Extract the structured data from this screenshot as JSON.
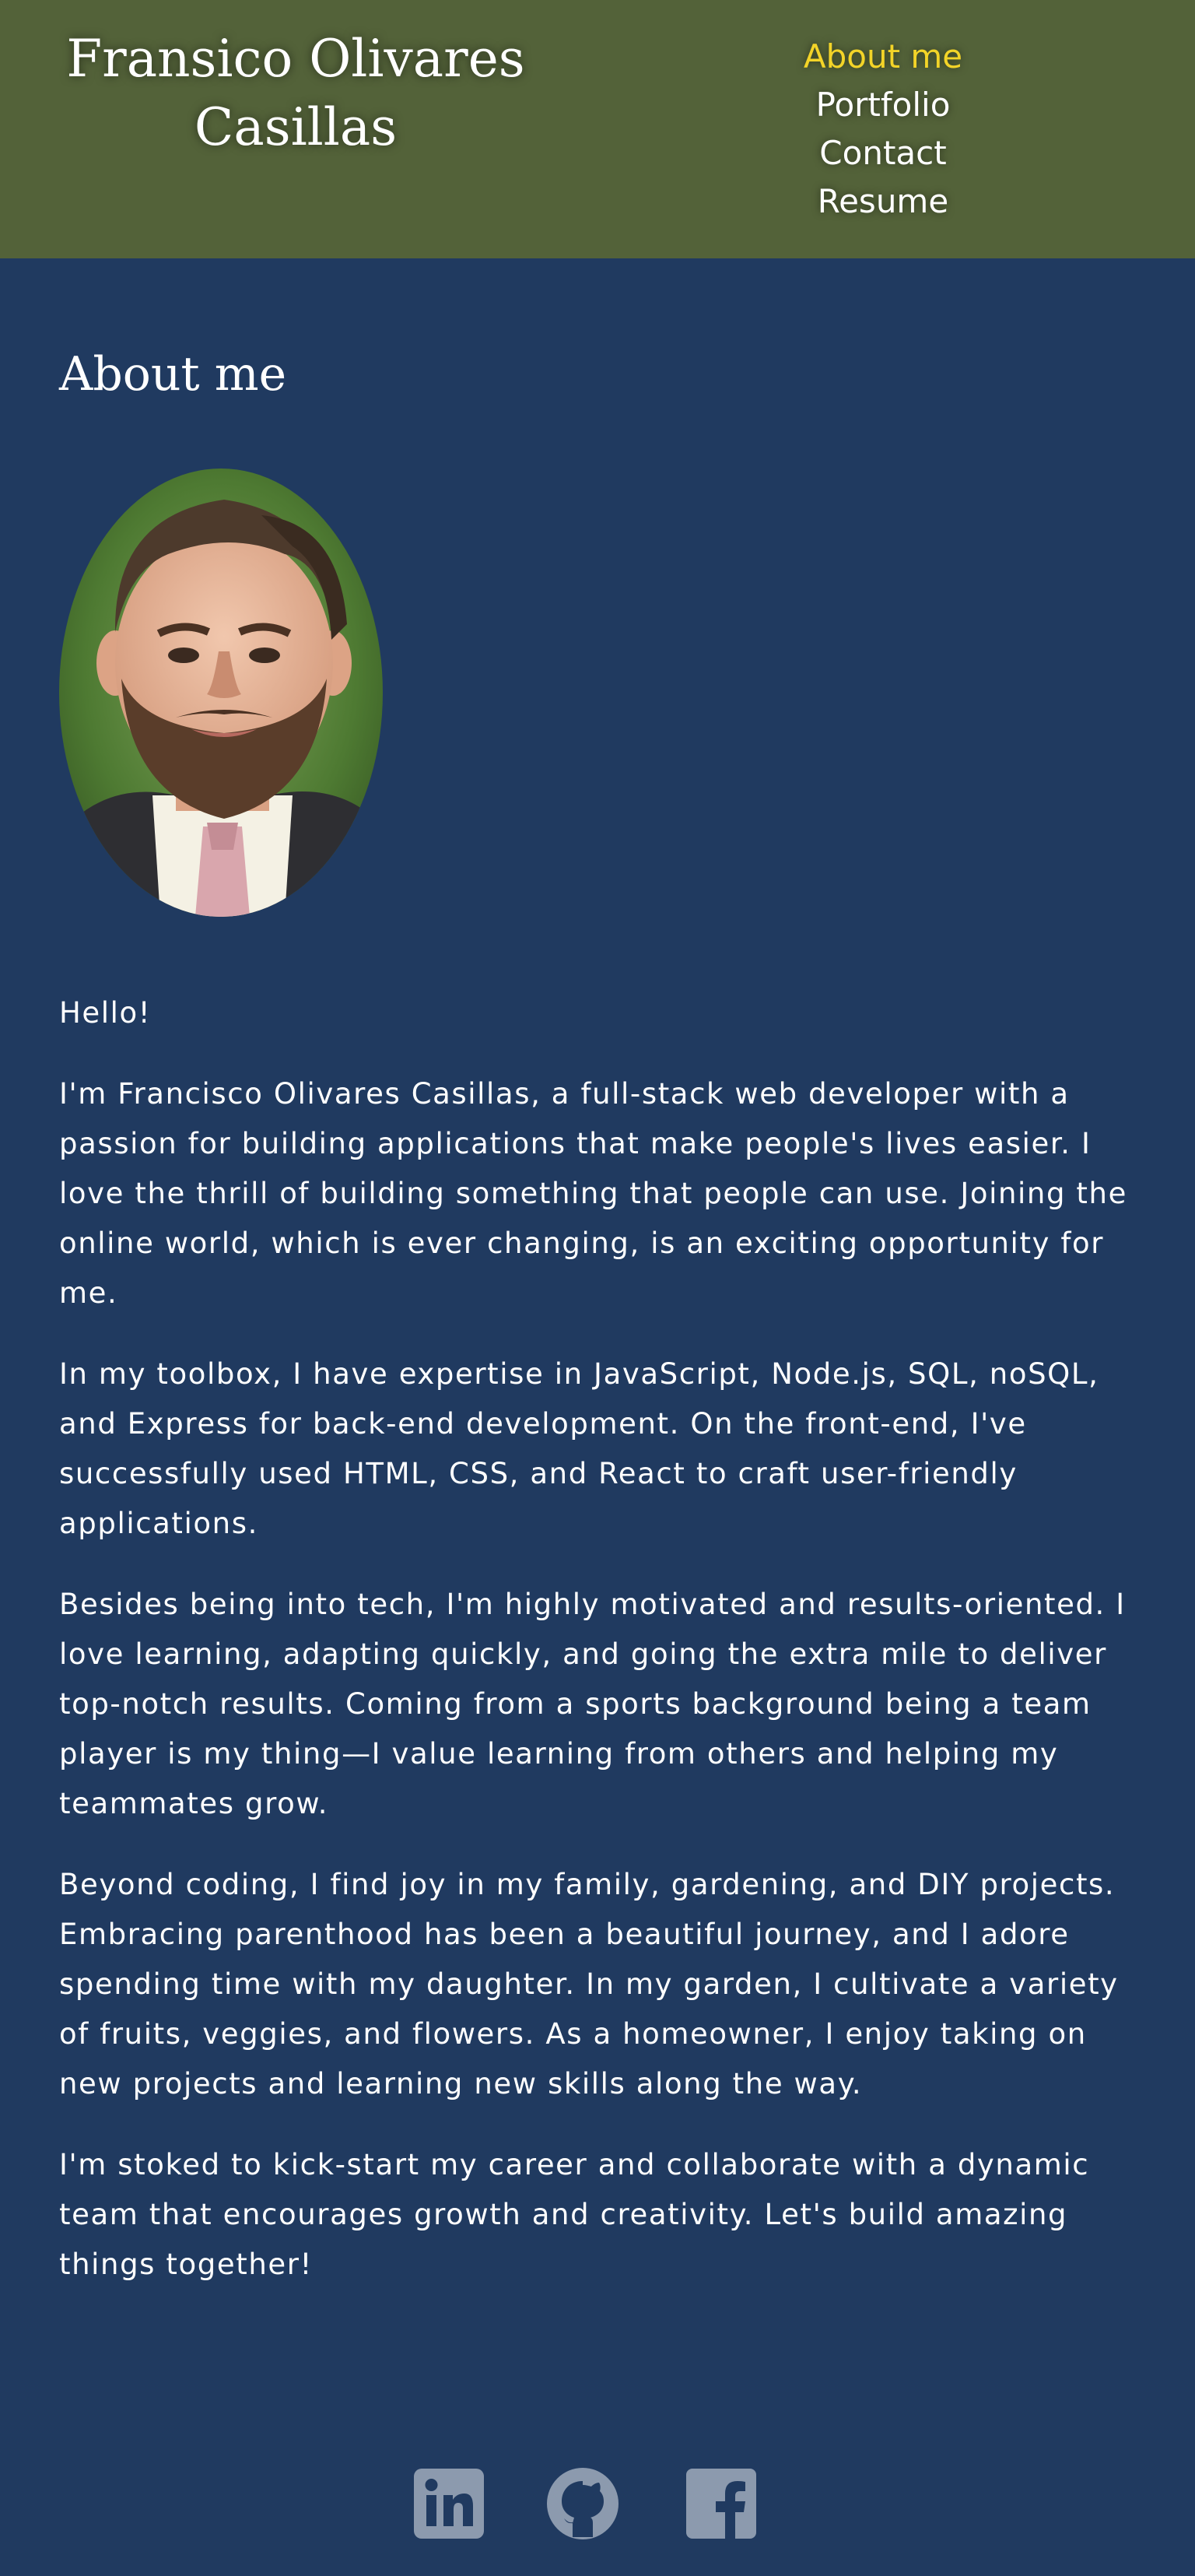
{
  "header": {
    "title": "Fransico Olivares Casillas",
    "nav": [
      {
        "label": "About me",
        "active": true
      },
      {
        "label": "Portfolio",
        "active": false
      },
      {
        "label": "Contact",
        "active": false
      },
      {
        "label": "Resume",
        "active": false
      }
    ]
  },
  "main": {
    "section_title": "About me",
    "paragraphs": [
      "Hello!",
      "I'm Francisco Olivares Casillas, a full-stack web developer with a passion for building applications that make people's lives easier. I love the thrill of building something that people can use. Joining the online world, which is ever changing, is an exciting opportunity for me.",
      "In my toolbox, I have expertise in JavaScript, Node.js, SQL, noSQL, and Express for back-end development. On the front-end, I've successfully used HTML, CSS, and React to craft user-friendly applications.",
      "Besides being into tech, I'm highly motivated and results-oriented. I love learning, adapting quickly, and going the extra mile to deliver top-notch results. Coming from a sports background being a team player is my thing—I value learning from others and helping my teammates grow.",
      "Beyond coding, I find joy in my family, gardening, and DIY projects. Embracing parenthood has been a beautiful journey, and I adore spending time with my daughter. In my garden, I cultivate a variety of fruits, veggies, and flowers. As a homeowner, I enjoy taking on new projects and learning new skills along the way.",
      "I'm stoked to kick-start my career and collaborate with a dynamic team that encourages growth and creativity. Let's build amazing things together!"
    ]
  },
  "footer": {
    "social": [
      {
        "icon": "linkedin-icon"
      },
      {
        "icon": "github-icon"
      },
      {
        "icon": "facebook-icon"
      }
    ]
  },
  "colors": {
    "header_bg": "#536239",
    "page_bg": "#203a60",
    "active_nav": "#f3d428",
    "text": "#ffffff",
    "icon": "#8c9aae"
  }
}
